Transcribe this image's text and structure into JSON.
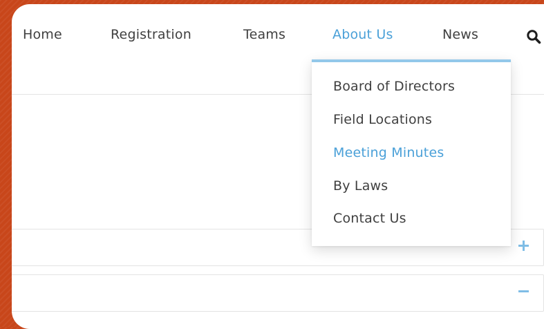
{
  "nav": {
    "items": [
      {
        "label": "Home",
        "active": false
      },
      {
        "label": "Registration",
        "active": false
      },
      {
        "label": "Teams",
        "active": false
      },
      {
        "label": "About Us",
        "active": true
      },
      {
        "label": "News",
        "active": false
      }
    ],
    "search_icon": "search-icon"
  },
  "dropdown": {
    "parent": "About Us",
    "items": [
      {
        "label": "Board of Directors",
        "highlighted": false
      },
      {
        "label": "Field Locations",
        "highlighted": false
      },
      {
        "label": "Meeting Minutes",
        "highlighted": true
      },
      {
        "label": "By Laws",
        "highlighted": false
      },
      {
        "label": "Contact Us",
        "highlighted": false
      }
    ]
  },
  "accordion": {
    "sections": [
      {
        "state": "collapsed",
        "icon": "plus-icon"
      },
      {
        "state": "expanded",
        "icon": "minus-icon"
      }
    ]
  },
  "colors": {
    "background": "#c8461a",
    "accent": "#4aa0d8",
    "dropdown_border": "#93c8ea",
    "text": "#3f3f3f"
  }
}
